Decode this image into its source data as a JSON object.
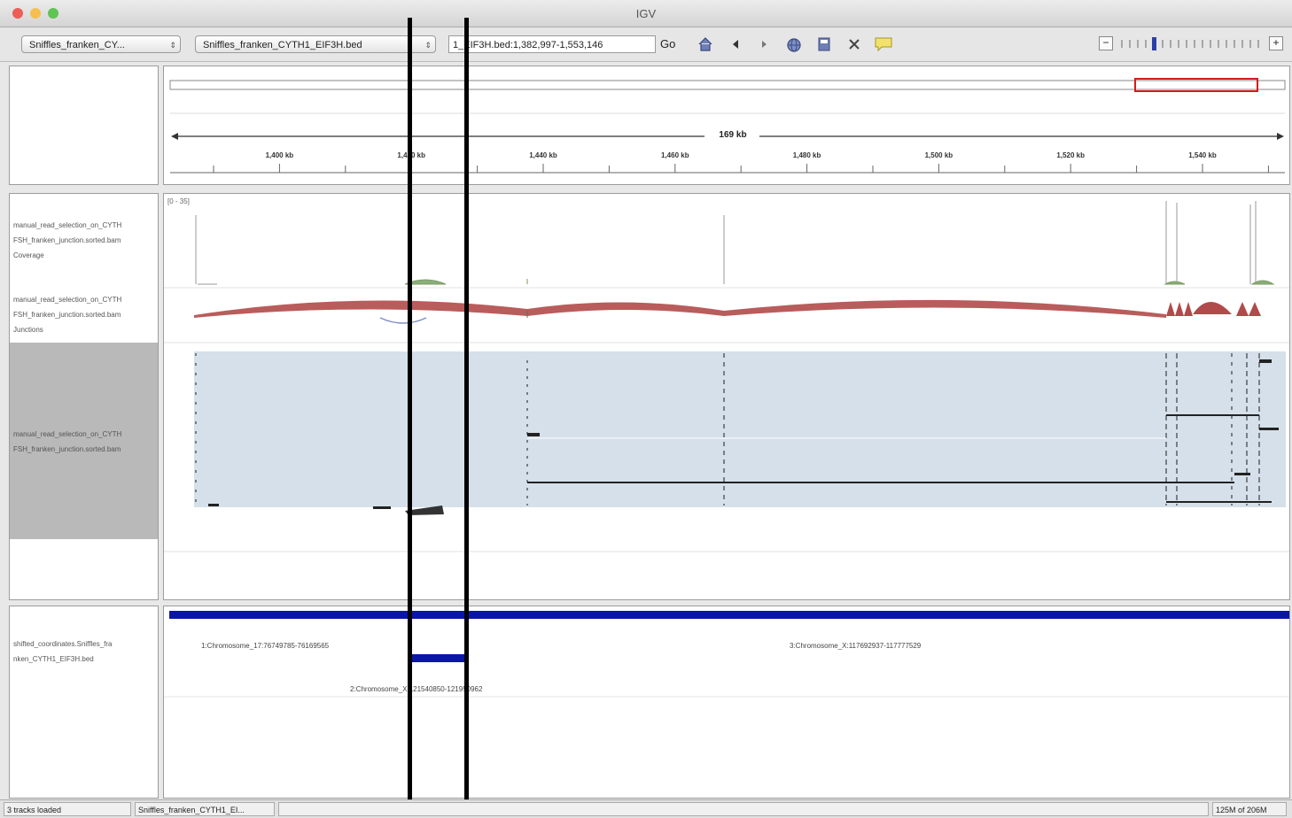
{
  "window": {
    "title": "IGV",
    "close_color": "#ec5f56",
    "minimize_color": "#f5bf4f",
    "zoom_color": "#5fc453"
  },
  "toolbar": {
    "genome_combo": "Sniffles_franken_CY...",
    "chromosome_combo": "Sniffles_franken_CYTH1_EIF3H.bed",
    "locus": "1_EIF3H.bed:1,382,997-1,553,146",
    "go_label": "Go",
    "icons": [
      "home-icon",
      "back-icon",
      "forward-icon",
      "refresh-icon",
      "roi-icon",
      "resize-icon",
      "popup-info-icon"
    ]
  },
  "ruler": {
    "span_label": "169 kb",
    "ticks": [
      "1,400 kb",
      "1,420 kb",
      "1,440 kb",
      "1,460 kb",
      "1,480 kb",
      "1,500 kb",
      "1,520 kb",
      "1,540 kb"
    ]
  },
  "tracks": {
    "coverage": {
      "name": "manual_read_selection_on_CYTH1_EIF3H_franken_junction.sorted.bam Coverage",
      "label_lines": [
        "manual_read_selection_on_CYTH",
        "FSH_franken_junction.sorted.bam",
        "Coverage"
      ],
      "range": "[0 - 35]"
    },
    "junctions": {
      "label_lines": [
        "manual_read_selection_on_CYTH",
        "FSH_franken_junction.sorted.bam",
        "Junctions"
      ]
    },
    "alignments": {
      "label_lines": [
        "manual_read_selection_on_CYTH",
        "FSH_franken_junction.sorted.bam"
      ]
    },
    "bed": {
      "label_lines": [
        "shifted_coordinates.Sniffles_fra",
        "nken_CYTH1_EIF3H.bed"
      ],
      "features": [
        "1:Chromosome_17:76749785-76169565",
        "2:Chromosome_X:121540850-121950962",
        "3:Chromosome_X:117692937-117777529"
      ]
    }
  },
  "status": {
    "tracks_loaded": "3 tracks loaded",
    "current_file": "Sniffles_franken_CYTH1_EI...",
    "memory": "125M of 206M"
  },
  "colors": {
    "coverage": "#9a9a9a",
    "junction_fill": "#b14a4a",
    "alignment_bg": "#d6e0ea",
    "bed_feature": "#0b16a8",
    "roi_box": "#d61a1a"
  }
}
